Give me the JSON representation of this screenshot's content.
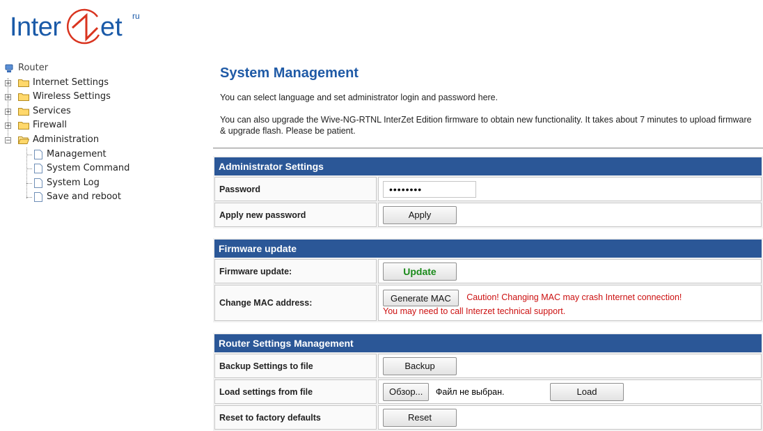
{
  "logo": {
    "part1": "Inter",
    "part2": "et",
    "suffix": "ru"
  },
  "tree": {
    "root": "Router",
    "folders": [
      "Internet Settings",
      "Wireless Settings",
      "Services",
      "Firewall",
      "Administration"
    ],
    "admin_items": [
      "Management",
      "System Command",
      "System Log",
      "Save and reboot"
    ]
  },
  "page": {
    "title": "System Management",
    "intro1": "You can select language and set administrator login and password here.",
    "intro2": "You can also upgrade the Wive-NG-RTNL InterZet Edition firmware to obtain new functionality. It takes about 7 minutes to upload firmware & upgrade flash. Please be patient."
  },
  "admin": {
    "header": "Administrator Settings",
    "password_label": "Password",
    "password_value": "••••••••",
    "apply_label": "Apply new password",
    "apply_button": "Apply"
  },
  "firmware": {
    "header": "Firmware update",
    "update_label": "Firmware update:",
    "update_button": "Update",
    "mac_label": "Change MAC address:",
    "mac_button": "Generate MAC",
    "caution1": "Caution! Changing MAC may crash Internet connection!",
    "caution2": "You may need to call Interzet technical support."
  },
  "router_mgmt": {
    "header": "Router Settings Management",
    "backup_label": "Backup Settings to file",
    "backup_button": "Backup",
    "load_label": "Load settings from file",
    "browse_button": "Обзор...",
    "no_file": "Файл не выбран.",
    "load_button": "Load",
    "reset_label": "Reset to factory defaults",
    "reset_button": "Reset"
  },
  "colors": {
    "header_bg": "#2b5797",
    "title": "#1f5aa6",
    "caution": "#cc1010",
    "update_text": "#1a8a1a"
  }
}
